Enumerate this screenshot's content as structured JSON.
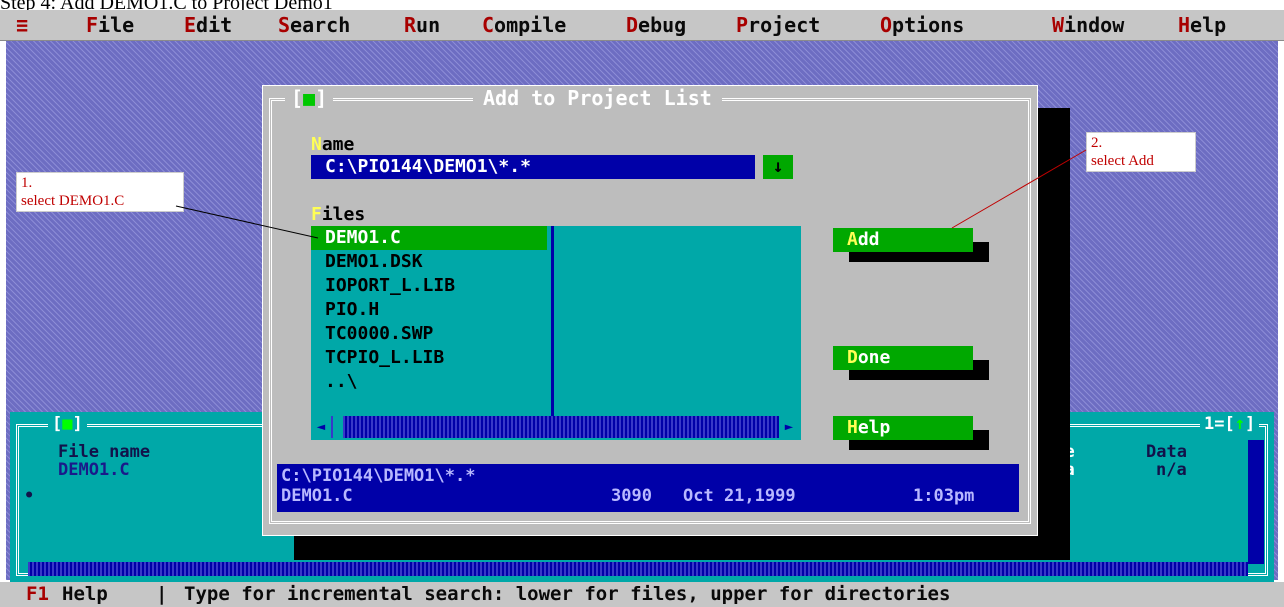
{
  "caption": "Step 4: Add DEMO1.C to Project Demo1",
  "menu": {
    "system": "≡",
    "items": [
      {
        "hk": "F",
        "rest": "ile"
      },
      {
        "hk": "E",
        "rest": "dit"
      },
      {
        "hk": "S",
        "rest": "earch"
      },
      {
        "hk": "R",
        "rest": "un"
      },
      {
        "hk": "C",
        "rest": "ompile"
      },
      {
        "hk": "D",
        "rest": "ebug"
      },
      {
        "hk": "P",
        "rest": "roject"
      },
      {
        "hk": "O",
        "rest": "ptions"
      },
      {
        "hk": "W",
        "rest": "indow"
      },
      {
        "hk": "H",
        "rest": "elp"
      }
    ]
  },
  "project_window": {
    "close_marker": "■",
    "window_number": "1",
    "arrow_up": "↑",
    "col_filename": "File name",
    "row_filename": "DEMO1.C",
    "col_code": "ode",
    "code_value": "n/a",
    "col_data": "Data",
    "data_value": "n/a"
  },
  "dialog": {
    "title": "Add to Project List",
    "close_marker": "■",
    "name_label_hk": "N",
    "name_label_rest": "ame",
    "name_value": "C:\\PIO144\\DEMO1\\*.*",
    "dropdown_arrow": "↓",
    "files_label_hk": "F",
    "files_label_rest": "iles",
    "files": [
      "DEMO1.C",
      "DEMO1.DSK",
      "IOPORT_L.LIB",
      "PIO.H",
      "TC0000.SWP",
      "TCPIO_L.LIB",
      "..\\"
    ],
    "selected_index": 0,
    "buttons": {
      "add_hk": "A",
      "add_rest": "dd",
      "done_hk": "D",
      "done_rest": "one",
      "help_hk": "H",
      "help_rest": "elp"
    },
    "status_path": "C:\\PIO144\\DEMO1\\*.*",
    "status_file": "DEMO1.C",
    "status_size": "3090",
    "status_date": "Oct 21,1999",
    "status_time": "1:03pm"
  },
  "annotations": {
    "note1_line1": "1.",
    "note1_line2": "select DEMO1.C",
    "note2_line1": "2.",
    "note2_line2": "select Add"
  },
  "statusbar": {
    "key": "F1",
    "key_label": "Help",
    "separator": "|",
    "hint": "Type for incremental search: lower for files, upper for directories"
  },
  "colors": {
    "menu_bg": "#c6c6c6",
    "desktop": "#6d6dc2",
    "dialog_bg": "#bdbdbd",
    "input_bg": "#0000a8",
    "list_bg": "#00a8a8",
    "selection": "#00a800",
    "hotkey": "#ffff55",
    "annotation": "#c00000"
  }
}
